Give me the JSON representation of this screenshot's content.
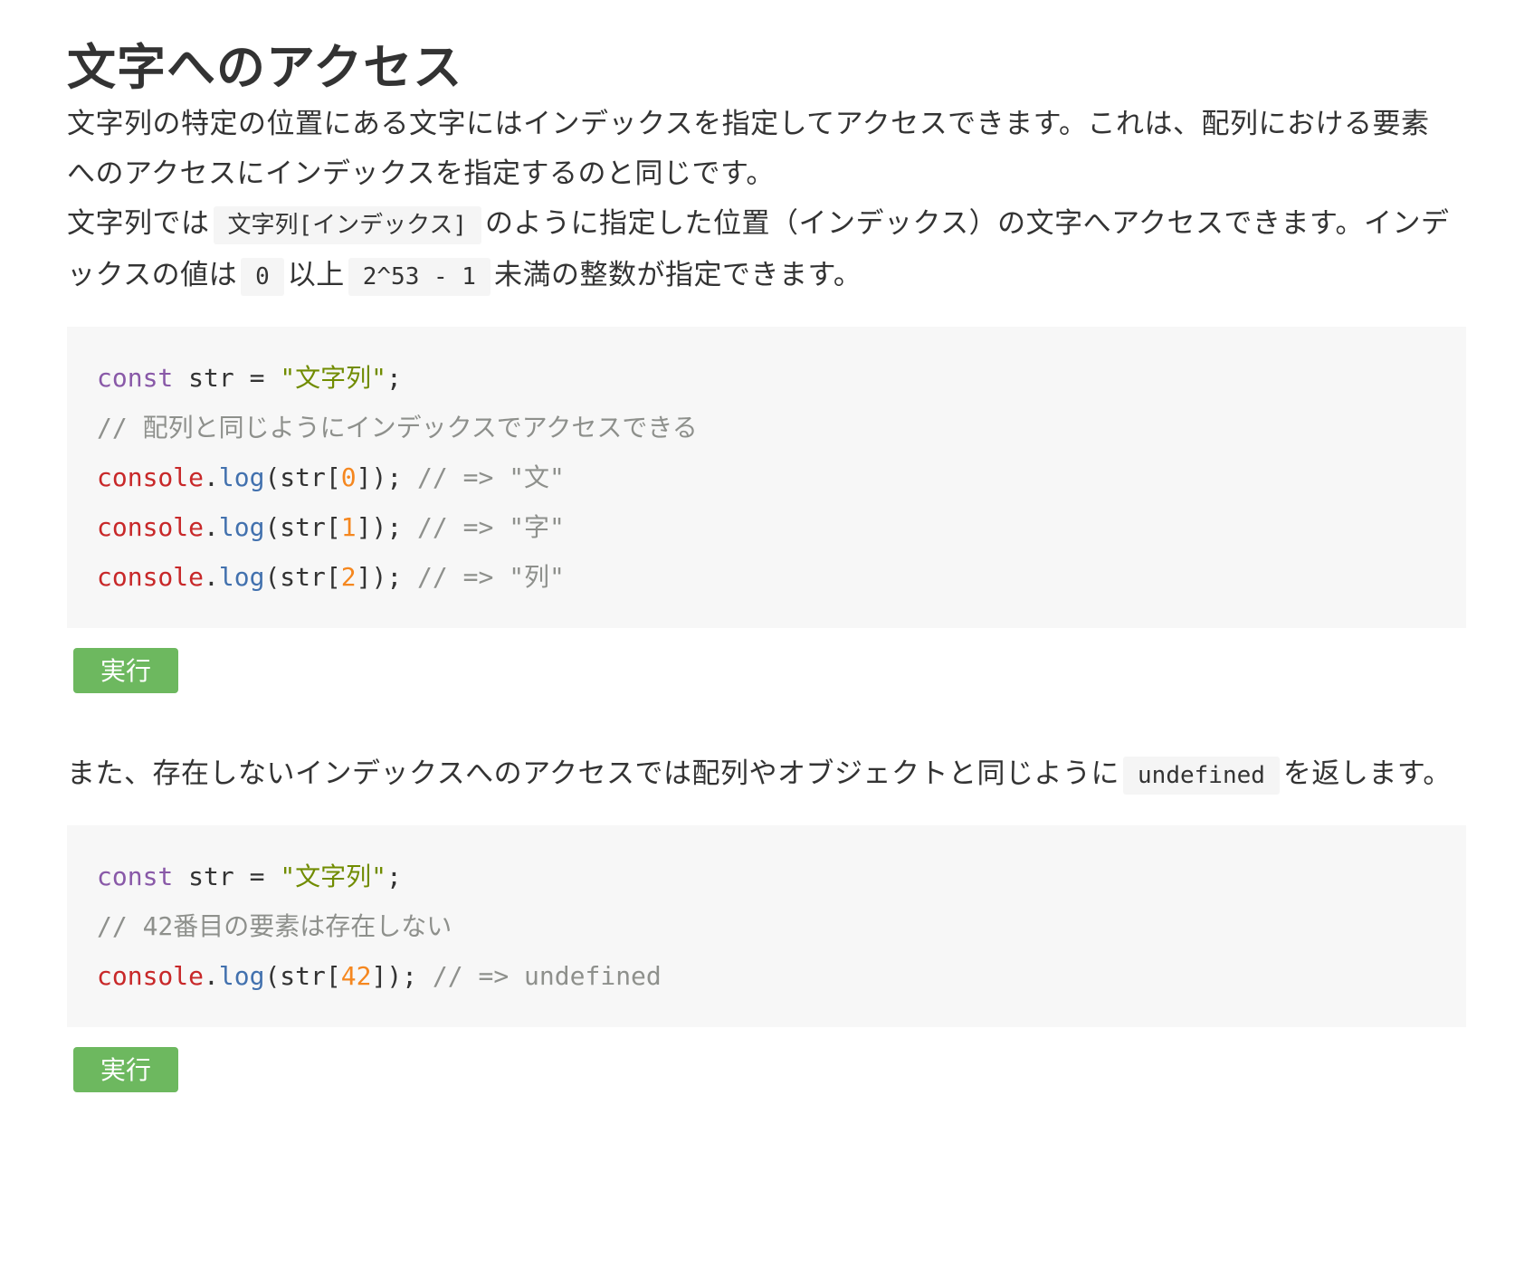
{
  "heading": "文字へのアクセス",
  "paragraph1": "文字列の特定の位置にある文字にはインデックスを指定してアクセスできます。これは、配列における要素へのアクセスにインデックスを指定するのと同じです。",
  "paragraph2": {
    "text1": "文字列では",
    "code1": "文字列[インデックス]",
    "text2": "のように指定した位置（インデックス）の文字へアクセスできます。インデックスの値は",
    "code2": "0",
    "text3": "以上",
    "code3": "2^53 - 1",
    "text4": "未満の整数が指定できます。"
  },
  "code_block_1": {
    "line1": {
      "kw": "const",
      "rest": " str = ",
      "str": "\"文字列\"",
      "end": ";"
    },
    "line2": {
      "comment": "// 配列と同じようにインデックスでアクセスできる"
    },
    "line3": {
      "obj": "console",
      "dot": ".",
      "fn": "log",
      "open": "(str[",
      "num": "0",
      "close": "]); ",
      "comment": "// => \"文\""
    },
    "line4": {
      "obj": "console",
      "dot": ".",
      "fn": "log",
      "open": "(str[",
      "num": "1",
      "close": "]); ",
      "comment": "// => \"字\""
    },
    "line5": {
      "obj": "console",
      "dot": ".",
      "fn": "log",
      "open": "(str[",
      "num": "2",
      "close": "]); ",
      "comment": "// => \"列\""
    }
  },
  "run_button_label": "実行",
  "paragraph3": {
    "text1": "また、存在しないインデックスへのアクセスでは配列やオブジェクトと同じように",
    "code1": "undefined",
    "text2": "を返します。"
  },
  "code_block_2": {
    "line1": {
      "kw": "const",
      "rest": " str = ",
      "str": "\"文字列\"",
      "end": ";"
    },
    "line2": {
      "comment": "// 42番目の要素は存在しない"
    },
    "line3": {
      "obj": "console",
      "dot": ".",
      "fn": "log",
      "open": "(str[",
      "num": "42",
      "close": "]); ",
      "comment": "// => undefined"
    }
  },
  "colors": {
    "keyword": "#8959a8",
    "string": "#718c00",
    "comment": "#8e908c",
    "object": "#c82829",
    "function": "#4271ae",
    "number": "#f5871f",
    "run_button": "#6db85f",
    "code_background": "#f7f7f7"
  }
}
